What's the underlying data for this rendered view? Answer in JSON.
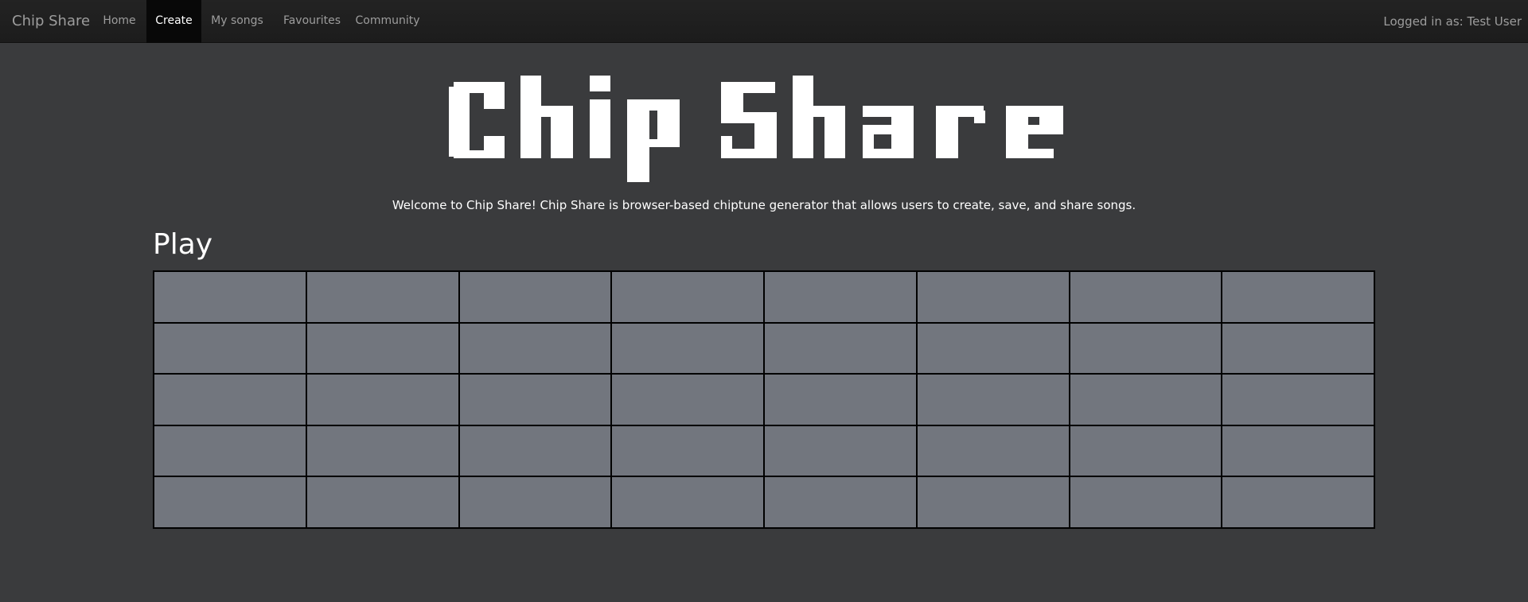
{
  "navbar": {
    "brand": "Chip Share",
    "items": [
      {
        "label": "Home",
        "active": false
      },
      {
        "label": "Create",
        "active": true
      },
      {
        "label": "My songs",
        "active": false
      },
      {
        "label": "Favourites",
        "active": false
      },
      {
        "label": "Community",
        "active": false
      }
    ],
    "login_status": "Logged in as: Test User"
  },
  "hero": {
    "logo_text": "Chip Share",
    "logo_color": "#ffffff",
    "tagline": "Welcome to Chip Share! Chip Share is browser-based chiptune generator that allows users to create, save, and share songs."
  },
  "play": {
    "title": "Play",
    "grid": {
      "columns": 8,
      "rows": 5,
      "active_cells": [],
      "cell_color": "#72767e",
      "border_color": "#000000"
    }
  }
}
